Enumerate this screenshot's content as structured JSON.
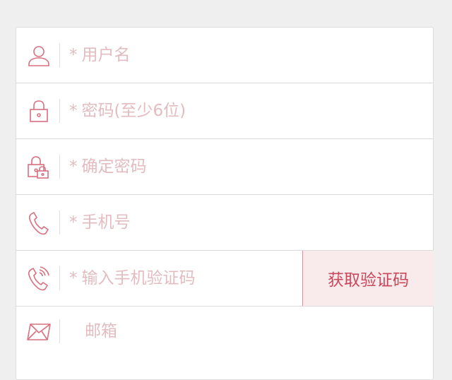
{
  "form": {
    "username": {
      "star": "*",
      "placeholder": "用户名"
    },
    "password": {
      "star": "*",
      "placeholder": "密码(至少6位)"
    },
    "confirm_password": {
      "star": "*",
      "placeholder": "确定密码"
    },
    "phone": {
      "star": "*",
      "placeholder": "手机号"
    },
    "verify_code": {
      "star": "*",
      "placeholder": "输入手机验证码",
      "button_label": "获取验证码"
    },
    "email": {
      "placeholder": "邮箱"
    }
  },
  "icons": {
    "username": "user-icon",
    "password": "lock-icon",
    "confirm_password": "double-lock-icon",
    "phone": "phone-icon",
    "verify_code": "phone-signal-icon",
    "email": "mail-icon"
  },
  "colors": {
    "accent": "#c9485b",
    "icon": "#d9707e",
    "placeholder": "#e3bcc0",
    "button_bg": "#f9eaeb",
    "border": "#dcdcdc",
    "page_bg": "#efefef"
  }
}
